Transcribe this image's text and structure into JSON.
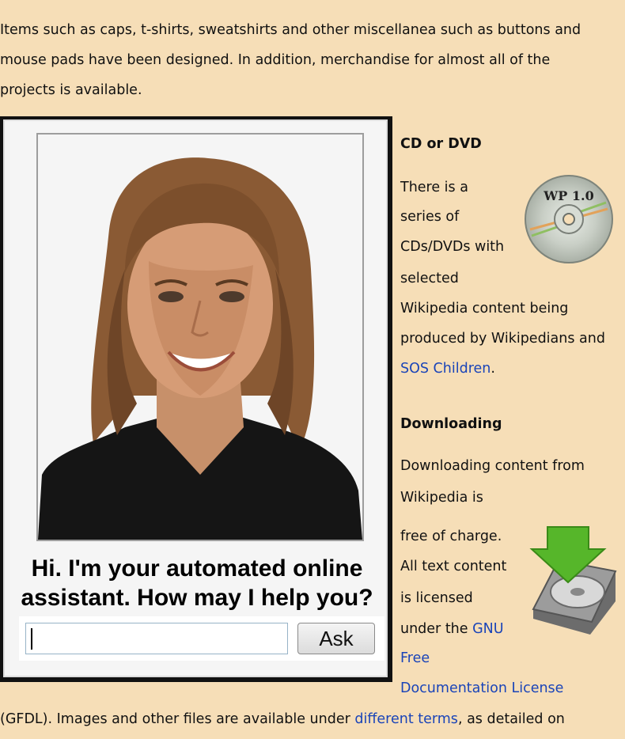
{
  "intro_lines": [
    "Items such as caps, t-shirts, sweatshirts and other miscellanea such as buttons and",
    "mouse pads have been designed. In addition, merchandise for almost all of the",
    "projects is available."
  ],
  "assistant": {
    "greeting": "Hi. I'm your automated online assistant. How may I help you?",
    "input_value": "",
    "ask_label": "Ask"
  },
  "cd_section": {
    "heading": "CD or DVD",
    "lines": [
      "There is a",
      "series of",
      "CDs/DVDs with",
      "selected",
      "Wikipedia content being",
      "produced by Wikipedians and"
    ],
    "link": "SOS Children",
    "after_link": ".",
    "badge_text": "WP 1.0"
  },
  "download_section": {
    "heading": "Downloading",
    "lines": [
      "Downloading content from",
      "Wikipedia is",
      "free of charge.",
      "All text content",
      "is licensed",
      "under the"
    ],
    "link_gnu": "GNU",
    "link_free": "Free",
    "link_license": "Documentation License"
  },
  "bottom": {
    "prefix": "(GFDL). Images and other files are available under ",
    "link": "different terms",
    "suffix": ", as detailed on"
  },
  "colors": {
    "page_bg": "#f6deb7",
    "link": "#1a44b8",
    "arrow": "#56b62a"
  }
}
